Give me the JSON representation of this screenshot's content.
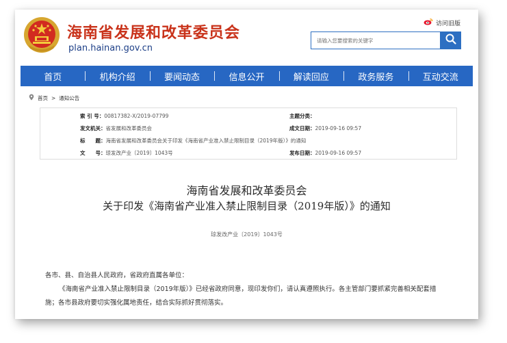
{
  "header": {
    "site_title": "海南省发展和改革委员会",
    "site_url": "plan.hainan.gov.cn",
    "old_site_link": "访问旧版",
    "search_placeholder": "请输入您要搜索的关键字",
    "emblem_icon": "national-emblem-icon",
    "weibo_icon": "weibo-icon",
    "search_icon": "search-icon"
  },
  "nav": {
    "items": [
      "首页",
      "机构介绍",
      "要闻动态",
      "信息公开",
      "解读回应",
      "政务服务",
      "互动交流"
    ]
  },
  "breadcrumb": {
    "home": "首页",
    "sep": ">",
    "current": "通知公告"
  },
  "meta": {
    "index_label": "索 引 号：",
    "index_value": "00817382-X/2019-07799",
    "topic_label": "主题分类：",
    "topic_value": "",
    "issuer_label": "发文机关：",
    "issuer_value": "省发展和改革委员会",
    "date_label": "成文日期：",
    "date_value": "2019-09-16 09:57",
    "title_label": "标　　题：",
    "title_value": "海南省发展和改革委员会关于印发《海南省产业准入禁止限制目录（2019年版）》的通知",
    "docno_label": "文　　号：",
    "docno_value": "琼发改产业〔2019〕1043号",
    "pub_label": "发布日期：",
    "pub_value": "2019-09-16 09:57"
  },
  "article": {
    "title_line1": "海南省发展和改革委员会",
    "title_line2": "关于印发《海南省产业准入禁止限制目录（2019年版）》的通知",
    "doc_number": "琼发改产业〔2019〕1043号",
    "salutation": "各市、县、自治县人民政府，省政府直属各单位：",
    "para1_line1": "《海南省产业准入禁止限制目录（2019年版）》已经省政府同意，现印发你们，请认真遵照执行。各主管部门要抓紧完善相关配套措",
    "para1_line2": "施；各市县政府要切实强化属地责任，结合实际抓好贯彻落实。"
  },
  "colors": {
    "brand_red": "#c9331b",
    "nav_blue": "#2767c3",
    "url_blue": "#1d3f87"
  }
}
